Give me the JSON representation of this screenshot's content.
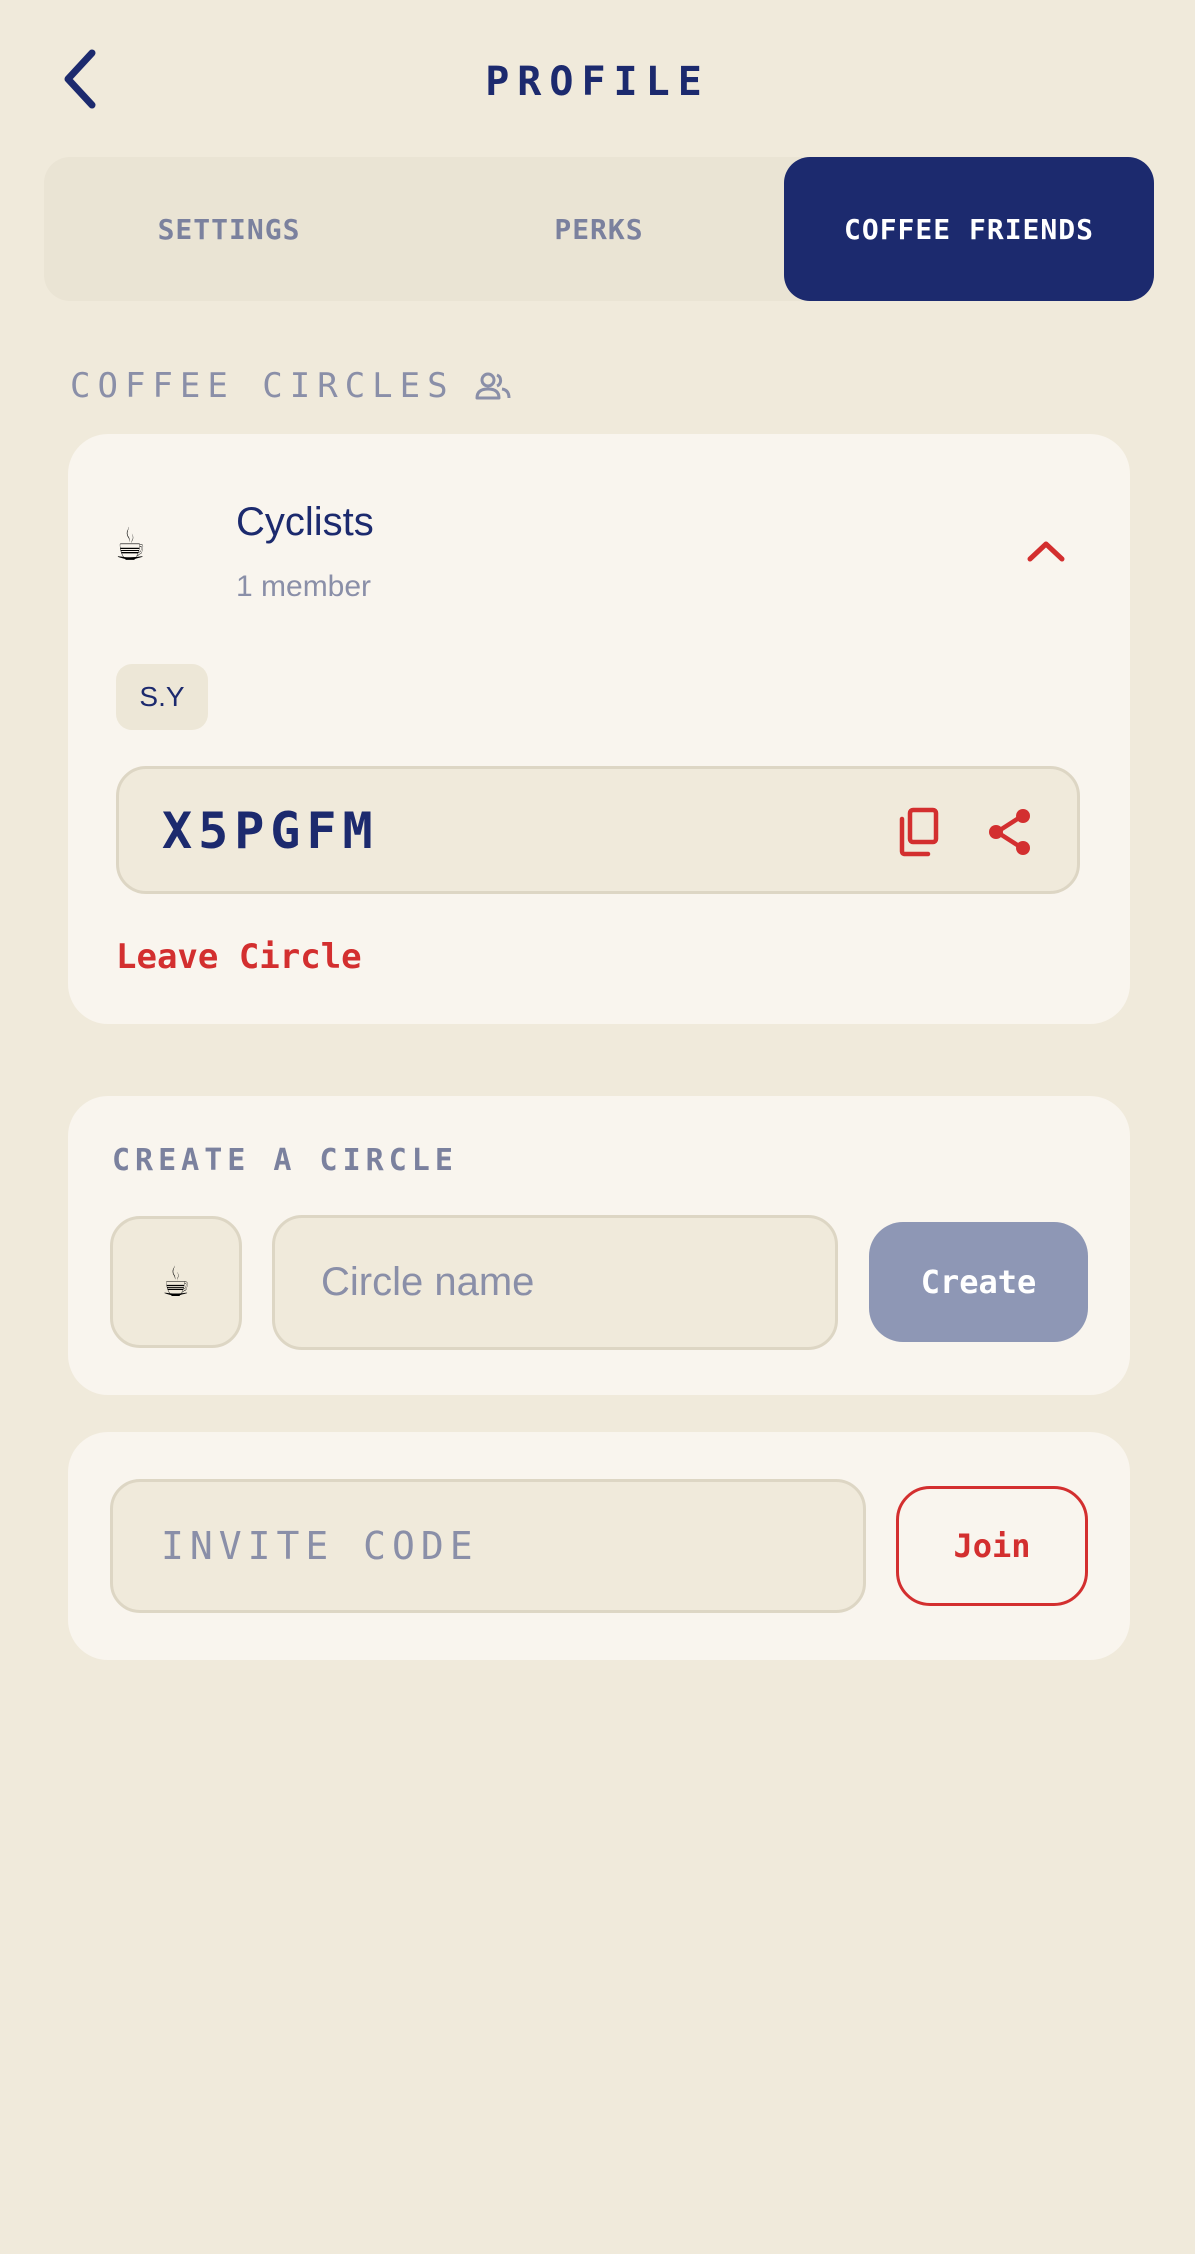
{
  "header": {
    "title": "PROFILE",
    "back_icon": "chevron-left-icon"
  },
  "tabs": [
    {
      "label": "SETTINGS",
      "active": false
    },
    {
      "label": "PERKS",
      "active": false
    },
    {
      "label": "COFFEE FRIENDS",
      "active": true
    }
  ],
  "circles_section": {
    "label": "COFFEE CIRCLES",
    "icon": "people-icon",
    "circles": [
      {
        "emoji": "☕",
        "name": "Cyclists",
        "member_count": "1 member",
        "expanded": true,
        "members": [
          "S.Y"
        ],
        "invite_code": "X5PGFM",
        "copy_icon": "copy-icon",
        "share_icon": "share-icon",
        "leave_label": "Leave Circle"
      }
    ]
  },
  "create_circle": {
    "label": "CREATE A CIRCLE",
    "emoji": "☕",
    "name_placeholder": "Circle name",
    "create_label": "Create"
  },
  "join_circle": {
    "code_placeholder": "INVITE CODE",
    "join_label": "Join"
  },
  "colors": {
    "background": "#F0EADB",
    "card": "#F9F5EE",
    "navy": "#1C2A6E",
    "accent_red": "#D32F2F",
    "muted": "#8A8FA8",
    "disabled_button": "#8E97B5"
  }
}
